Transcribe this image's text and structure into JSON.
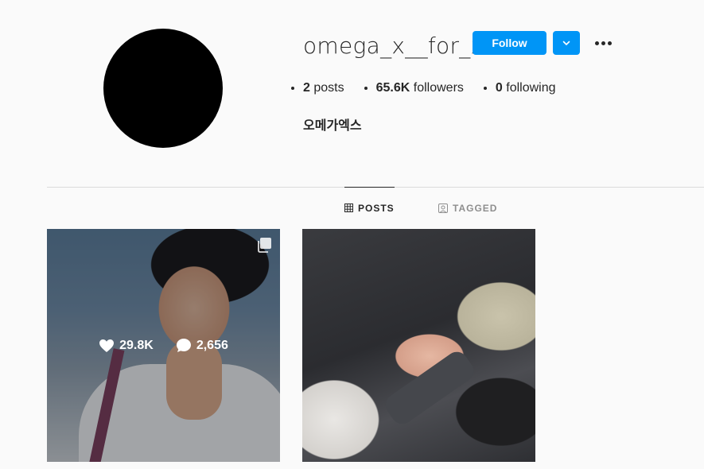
{
  "profile": {
    "username": "omega_x__for_x",
    "full_name": "오메가엑스",
    "follow_label": "Follow",
    "stats": [
      {
        "value": "2",
        "label": "posts"
      },
      {
        "value": "65.6K",
        "label": "followers"
      },
      {
        "value": "0",
        "label": "following"
      }
    ]
  },
  "tabs": [
    {
      "label": "POSTS",
      "icon": "grid-icon",
      "active": true
    },
    {
      "label": "TAGGED",
      "icon": "tag-user-icon",
      "active": false
    }
  ],
  "posts": [
    {
      "likes": "29.8K",
      "comments": "2,656",
      "multi": true,
      "hovered": true
    },
    {
      "likes": "",
      "comments": "",
      "multi": false,
      "hovered": false
    }
  ],
  "colors": {
    "accent": "#0095f6",
    "background": "#fafafa",
    "text": "#262626",
    "muted": "#8e8e8e",
    "divider": "#dbdbdb"
  }
}
